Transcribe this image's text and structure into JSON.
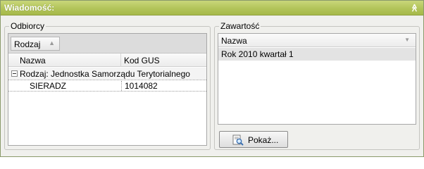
{
  "panel": {
    "title": "Wiadomość:",
    "collapse_icon": "double-chevron-up-icon",
    "collapse_glyph": "≪"
  },
  "recipients": {
    "legend": "Odbiorcy",
    "group_by_chip": {
      "label": "Rodzaj",
      "sort_glyph": "▲"
    },
    "columns": [
      "Nazwa",
      "Kod GUS"
    ],
    "groups": [
      {
        "label": "Rodzaj: Jednostka Samorządu Terytorialnego",
        "rows": [
          {
            "name": "SIERADZ",
            "kod_gus": "1014082"
          }
        ]
      }
    ]
  },
  "contents": {
    "legend": "Zawartość",
    "column": "Nazwa",
    "sort_glyph": "▼",
    "rows": [
      "Rok 2010 kwartał 1"
    ]
  },
  "actions": {
    "show_button": "Pokaż...",
    "show_icon": "preview-magnifier-icon"
  },
  "colors": {
    "titlebar": "#b2c45a",
    "selected_row": "#e3e3e3",
    "panel_bg": "#f0f0ed"
  }
}
